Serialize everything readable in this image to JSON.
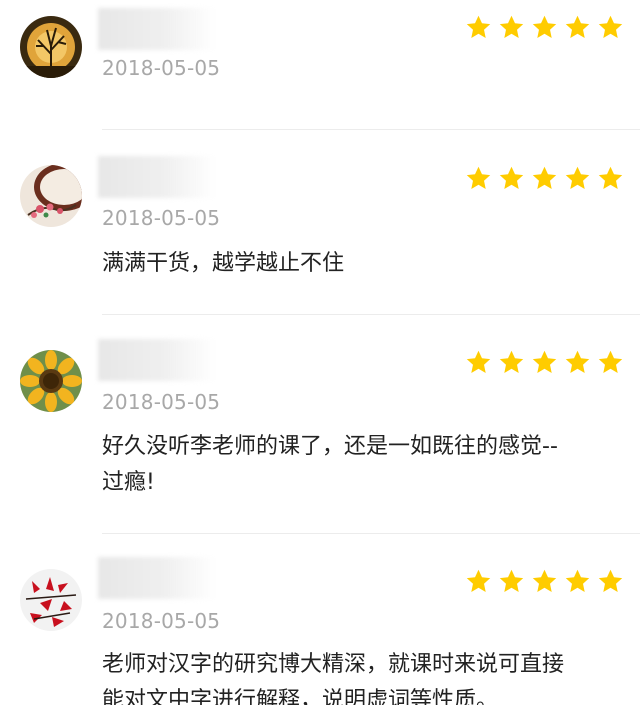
{
  "theme": {
    "star_color": "#ffcc00",
    "date_color": "#a8a8a8",
    "text_color": "#222222"
  },
  "reviews": [
    {
      "date": "2018-05-05",
      "rating": 5,
      "avatar_icon": "sunset-tree-avatar",
      "comment": ""
    },
    {
      "date": "2018-05-05",
      "rating": 5,
      "avatar_icon": "plum-blossom-avatar",
      "comment": "满满干货，越学越止不住"
    },
    {
      "date": "2018-05-05",
      "rating": 5,
      "avatar_icon": "sunflower-avatar",
      "comment": "好久没听李老师的课了，还是一如既往的感觉--\n过瘾!"
    },
    {
      "date": "2018-05-05",
      "rating": 5,
      "avatar_icon": "red-maple-avatar",
      "comment": "老师对汉字的研究博大精深，就课时来说可直接\n能对文中字进行解释，说明虚词等性质。"
    }
  ]
}
